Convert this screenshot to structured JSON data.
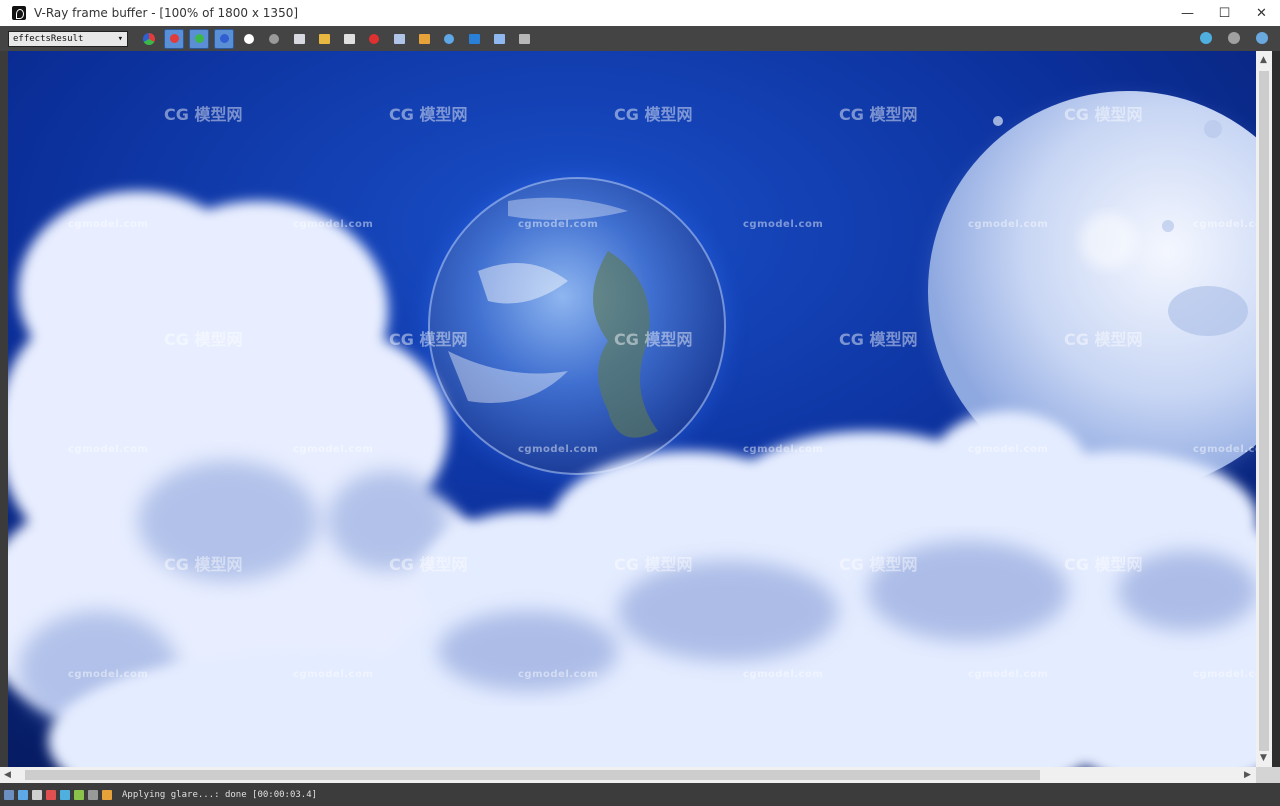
{
  "window": {
    "title": "V-Ray frame buffer - [100% of 1800 x 1350]",
    "controls": [
      "—",
      "☐",
      "✕"
    ]
  },
  "toolbar": {
    "channel_select": "effectsResult",
    "channel_arrow": "▾",
    "buttons": [
      {
        "name": "rgb-channels-icon",
        "type": "multi"
      },
      {
        "name": "red-channel-button",
        "type": "rgb",
        "color": "#e23b3b"
      },
      {
        "name": "green-channel-button",
        "type": "rgb",
        "color": "#3bb84a"
      },
      {
        "name": "blue-channel-button",
        "type": "rgb",
        "color": "#2f5fd0"
      },
      {
        "name": "alpha-white-icon",
        "type": "dot",
        "color": "#ffffff"
      },
      {
        "name": "mono-gray-icon",
        "type": "dot",
        "color": "#9a9a9a"
      },
      {
        "name": "save-image-icon",
        "type": "sq",
        "color": "#d8d8e0"
      },
      {
        "name": "open-folder-icon",
        "type": "sq",
        "color": "#e8b840"
      },
      {
        "name": "clear-image-icon",
        "type": "sq",
        "color": "#e0e0e0"
      },
      {
        "name": "stop-render-icon",
        "type": "dot",
        "color": "#e03030"
      },
      {
        "name": "region-render-icon",
        "type": "sq",
        "color": "#b0c4e8"
      },
      {
        "name": "track-mouse-icon",
        "type": "sq",
        "color": "#e8a23a"
      },
      {
        "name": "render-icon",
        "type": "dot",
        "color": "#5fa8e8"
      },
      {
        "name": "display-settings-icon",
        "type": "sq",
        "color": "#2a7fd6"
      },
      {
        "name": "color-correction-icon",
        "type": "sq",
        "color": "#8fb8f0"
      },
      {
        "name": "lens-effects-icon",
        "type": "sq",
        "color": "#b8b8b8"
      }
    ],
    "right_buttons": [
      {
        "name": "layers-globe-icon",
        "color": "#4fb0e0"
      },
      {
        "name": "pixel-info-icon",
        "color": "#a0a0a0"
      },
      {
        "name": "teapot-render-icon",
        "color": "#6aa8e0"
      }
    ]
  },
  "watermarks": {
    "domain": "cgmodel.com",
    "cn": "模型网",
    "logo": "CG"
  },
  "status": {
    "text": "Applying glare...: done [00:00:03.4]"
  },
  "scrollbars": {
    "left_arrow": "◀",
    "right_arrow": "▶",
    "up_arrow": "▲",
    "down_arrow": "▼"
  }
}
